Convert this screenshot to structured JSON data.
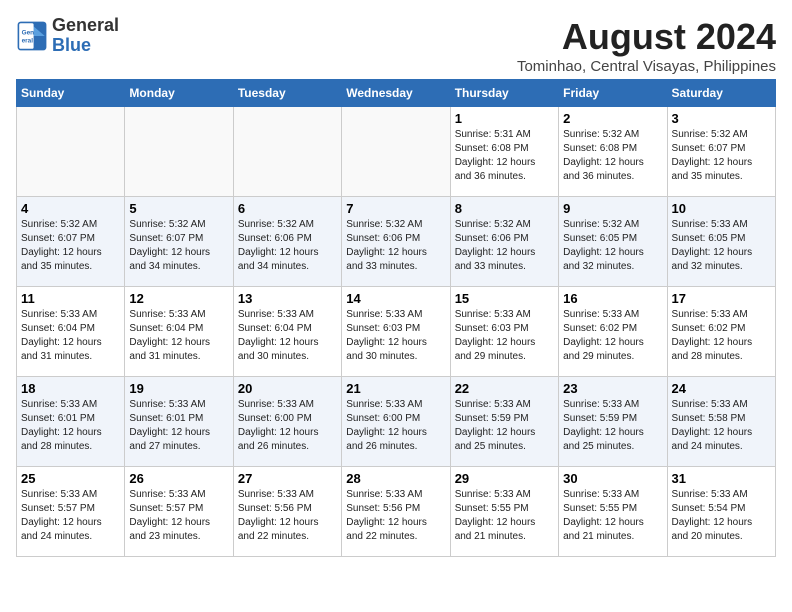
{
  "header": {
    "logo_line1": "General",
    "logo_line2": "Blue",
    "main_title": "August 2024",
    "subtitle": "Tominhao, Central Visayas, Philippines"
  },
  "weekdays": [
    "Sunday",
    "Monday",
    "Tuesday",
    "Wednesday",
    "Thursday",
    "Friday",
    "Saturday"
  ],
  "weeks": [
    [
      {
        "day": "",
        "info": ""
      },
      {
        "day": "",
        "info": ""
      },
      {
        "day": "",
        "info": ""
      },
      {
        "day": "",
        "info": ""
      },
      {
        "day": "1",
        "info": "Sunrise: 5:31 AM\nSunset: 6:08 PM\nDaylight: 12 hours\nand 36 minutes."
      },
      {
        "day": "2",
        "info": "Sunrise: 5:32 AM\nSunset: 6:08 PM\nDaylight: 12 hours\nand 36 minutes."
      },
      {
        "day": "3",
        "info": "Sunrise: 5:32 AM\nSunset: 6:07 PM\nDaylight: 12 hours\nand 35 minutes."
      }
    ],
    [
      {
        "day": "4",
        "info": "Sunrise: 5:32 AM\nSunset: 6:07 PM\nDaylight: 12 hours\nand 35 minutes."
      },
      {
        "day": "5",
        "info": "Sunrise: 5:32 AM\nSunset: 6:07 PM\nDaylight: 12 hours\nand 34 minutes."
      },
      {
        "day": "6",
        "info": "Sunrise: 5:32 AM\nSunset: 6:06 PM\nDaylight: 12 hours\nand 34 minutes."
      },
      {
        "day": "7",
        "info": "Sunrise: 5:32 AM\nSunset: 6:06 PM\nDaylight: 12 hours\nand 33 minutes."
      },
      {
        "day": "8",
        "info": "Sunrise: 5:32 AM\nSunset: 6:06 PM\nDaylight: 12 hours\nand 33 minutes."
      },
      {
        "day": "9",
        "info": "Sunrise: 5:32 AM\nSunset: 6:05 PM\nDaylight: 12 hours\nand 32 minutes."
      },
      {
        "day": "10",
        "info": "Sunrise: 5:33 AM\nSunset: 6:05 PM\nDaylight: 12 hours\nand 32 minutes."
      }
    ],
    [
      {
        "day": "11",
        "info": "Sunrise: 5:33 AM\nSunset: 6:04 PM\nDaylight: 12 hours\nand 31 minutes."
      },
      {
        "day": "12",
        "info": "Sunrise: 5:33 AM\nSunset: 6:04 PM\nDaylight: 12 hours\nand 31 minutes."
      },
      {
        "day": "13",
        "info": "Sunrise: 5:33 AM\nSunset: 6:04 PM\nDaylight: 12 hours\nand 30 minutes."
      },
      {
        "day": "14",
        "info": "Sunrise: 5:33 AM\nSunset: 6:03 PM\nDaylight: 12 hours\nand 30 minutes."
      },
      {
        "day": "15",
        "info": "Sunrise: 5:33 AM\nSunset: 6:03 PM\nDaylight: 12 hours\nand 29 minutes."
      },
      {
        "day": "16",
        "info": "Sunrise: 5:33 AM\nSunset: 6:02 PM\nDaylight: 12 hours\nand 29 minutes."
      },
      {
        "day": "17",
        "info": "Sunrise: 5:33 AM\nSunset: 6:02 PM\nDaylight: 12 hours\nand 28 minutes."
      }
    ],
    [
      {
        "day": "18",
        "info": "Sunrise: 5:33 AM\nSunset: 6:01 PM\nDaylight: 12 hours\nand 28 minutes."
      },
      {
        "day": "19",
        "info": "Sunrise: 5:33 AM\nSunset: 6:01 PM\nDaylight: 12 hours\nand 27 minutes."
      },
      {
        "day": "20",
        "info": "Sunrise: 5:33 AM\nSunset: 6:00 PM\nDaylight: 12 hours\nand 26 minutes."
      },
      {
        "day": "21",
        "info": "Sunrise: 5:33 AM\nSunset: 6:00 PM\nDaylight: 12 hours\nand 26 minutes."
      },
      {
        "day": "22",
        "info": "Sunrise: 5:33 AM\nSunset: 5:59 PM\nDaylight: 12 hours\nand 25 minutes."
      },
      {
        "day": "23",
        "info": "Sunrise: 5:33 AM\nSunset: 5:59 PM\nDaylight: 12 hours\nand 25 minutes."
      },
      {
        "day": "24",
        "info": "Sunrise: 5:33 AM\nSunset: 5:58 PM\nDaylight: 12 hours\nand 24 minutes."
      }
    ],
    [
      {
        "day": "25",
        "info": "Sunrise: 5:33 AM\nSunset: 5:57 PM\nDaylight: 12 hours\nand 24 minutes."
      },
      {
        "day": "26",
        "info": "Sunrise: 5:33 AM\nSunset: 5:57 PM\nDaylight: 12 hours\nand 23 minutes."
      },
      {
        "day": "27",
        "info": "Sunrise: 5:33 AM\nSunset: 5:56 PM\nDaylight: 12 hours\nand 22 minutes."
      },
      {
        "day": "28",
        "info": "Sunrise: 5:33 AM\nSunset: 5:56 PM\nDaylight: 12 hours\nand 22 minutes."
      },
      {
        "day": "29",
        "info": "Sunrise: 5:33 AM\nSunset: 5:55 PM\nDaylight: 12 hours\nand 21 minutes."
      },
      {
        "day": "30",
        "info": "Sunrise: 5:33 AM\nSunset: 5:55 PM\nDaylight: 12 hours\nand 21 minutes."
      },
      {
        "day": "31",
        "info": "Sunrise: 5:33 AM\nSunset: 5:54 PM\nDaylight: 12 hours\nand 20 minutes."
      }
    ]
  ]
}
